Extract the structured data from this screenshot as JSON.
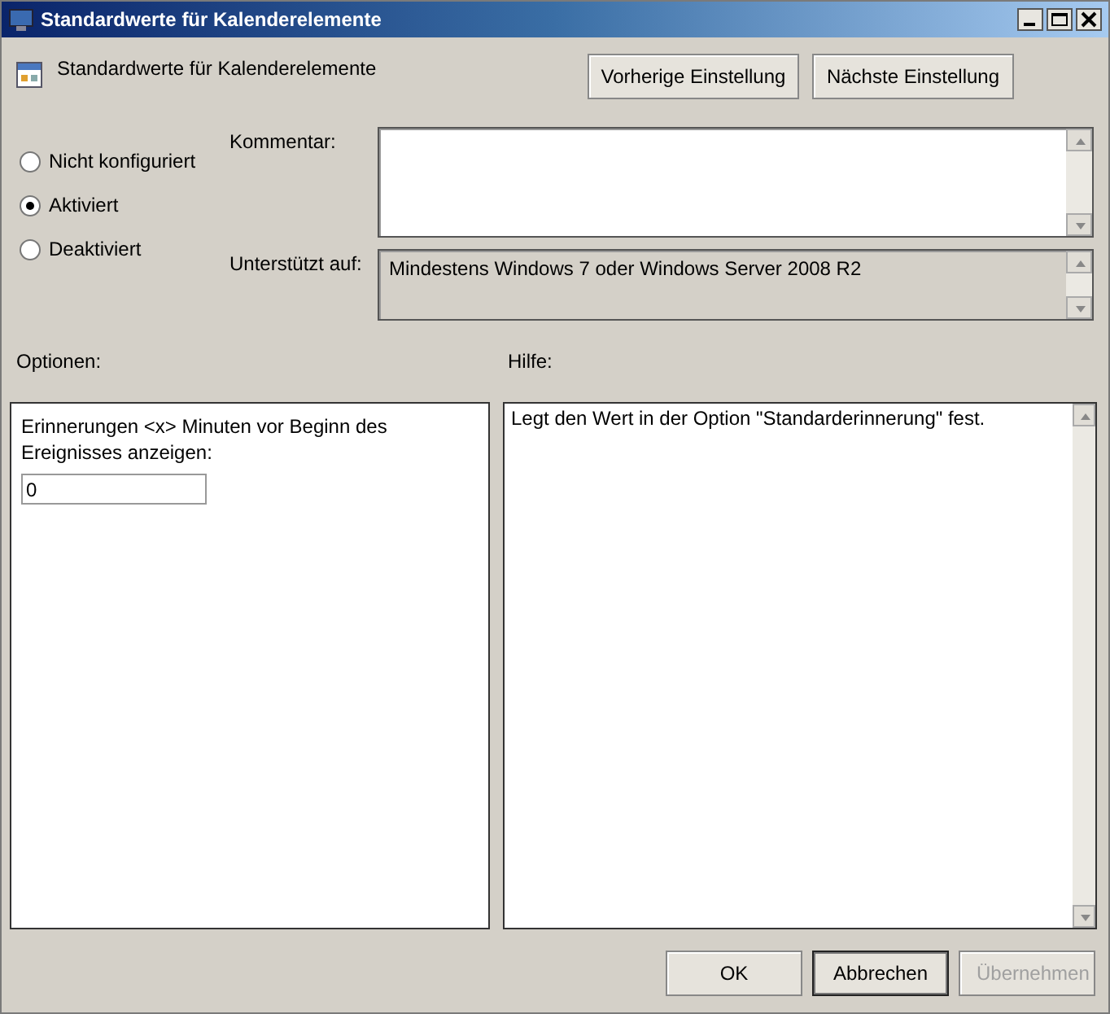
{
  "window": {
    "title": "Standardwerte für Kalenderelemente"
  },
  "header": {
    "setting_name": "Standardwerte für Kalenderelemente",
    "nav_buttons": [
      "Vorherige Einstellung",
      "Nächste Einstellung"
    ]
  },
  "state_options": [
    {
      "label": "Nicht konfiguriert",
      "selected": false
    },
    {
      "label": "Aktiviert",
      "selected": true
    },
    {
      "label": "Deaktiviert",
      "selected": false
    }
  ],
  "comment": {
    "label": "Kommentar:"
  },
  "supported_on": {
    "label": "Unterstützt auf:",
    "value": "Mindestens Windows 7 oder Windows Server 2008 R2"
  },
  "options": {
    "label": "Optionen:",
    "description": "Erinnerungen <x> Minuten vor Beginn des Ereignisses anzeigen:",
    "value": "0"
  },
  "help": {
    "label": "Hilfe:",
    "text": "Legt den Wert in der Option \"Standarderinnerung\" fest."
  },
  "buttons": [
    {
      "label": "OK",
      "default": false,
      "disabled": false
    },
    {
      "label": "Abbrechen",
      "default": true,
      "disabled": false
    },
    {
      "label": "Übernehmen",
      "default": false,
      "disabled": true
    }
  ]
}
